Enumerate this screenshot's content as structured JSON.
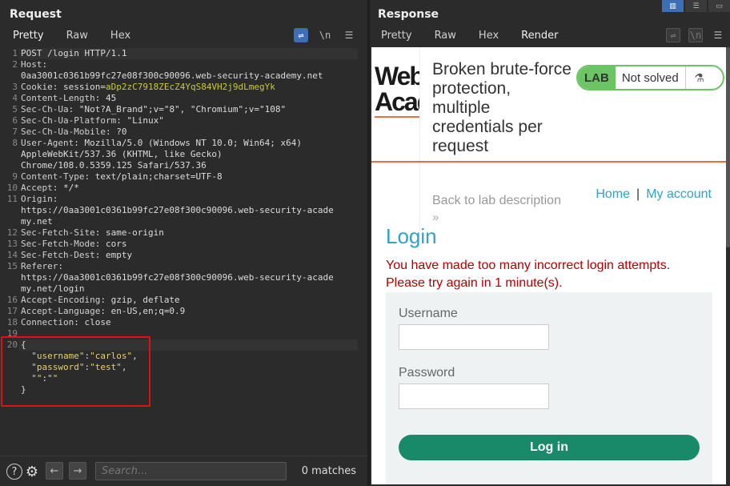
{
  "request": {
    "title": "Request",
    "tabs": [
      "Pretty",
      "Raw",
      "Hex"
    ],
    "tools": {
      "wrap": "⇌",
      "newline": "\\n",
      "menu": "☰"
    },
    "lines": [
      {
        "n": "1",
        "parts": [
          {
            "t": "POST /login HTTP/1.1",
            "c": "v"
          }
        ]
      },
      {
        "n": "2",
        "parts": [
          {
            "t": "Host",
            "c": "k"
          },
          {
            "t": ":",
            "c": "v"
          }
        ]
      },
      {
        "n": "",
        "parts": [
          {
            "t": "0aa3001c0361b99fc27e08f300c90096.web-security-academy.net",
            "c": "v"
          }
        ]
      },
      {
        "n": "3",
        "parts": [
          {
            "t": "Cookie",
            "c": "k"
          },
          {
            "t": ": session=",
            "c": "v"
          },
          {
            "t": "aDp2zC7918ZEcZ4YqS84VH2j9dLmegYk",
            "c": "cv"
          }
        ]
      },
      {
        "n": "4",
        "parts": [
          {
            "t": "Content-Length",
            "c": "k"
          },
          {
            "t": ": 45",
            "c": "v"
          }
        ]
      },
      {
        "n": "5",
        "parts": [
          {
            "t": "Sec-Ch-Ua",
            "c": "k"
          },
          {
            "t": ": \"Not?A_Brand\";v=\"8\", \"Chromium\";v=\"108\"",
            "c": "v"
          }
        ]
      },
      {
        "n": "6",
        "parts": [
          {
            "t": "Sec-Ch-Ua-Platform",
            "c": "k"
          },
          {
            "t": ": \"Linux\"",
            "c": "v"
          }
        ]
      },
      {
        "n": "7",
        "parts": [
          {
            "t": "Sec-Ch-Ua-Mobile",
            "c": "k"
          },
          {
            "t": ": ?0",
            "c": "v"
          }
        ]
      },
      {
        "n": "8",
        "parts": [
          {
            "t": "User-Agent",
            "c": "k"
          },
          {
            "t": ": Mozilla/5.0 (Windows NT 10.0; Win64; x64)",
            "c": "v"
          }
        ]
      },
      {
        "n": "",
        "parts": [
          {
            "t": "AppleWebKit/537.36 (KHTML, like Gecko)",
            "c": "v"
          }
        ]
      },
      {
        "n": "",
        "parts": [
          {
            "t": "Chrome/108.0.5359.125 Safari/537.36",
            "c": "v"
          }
        ]
      },
      {
        "n": "9",
        "parts": [
          {
            "t": "Content-Type",
            "c": "k"
          },
          {
            "t": ": text/plain;charset=UTF-8",
            "c": "v"
          }
        ]
      },
      {
        "n": "10",
        "parts": [
          {
            "t": "Accept",
            "c": "k"
          },
          {
            "t": ": */*",
            "c": "v"
          }
        ]
      },
      {
        "n": "11",
        "parts": [
          {
            "t": "Origin",
            "c": "k"
          },
          {
            "t": ":",
            "c": "v"
          }
        ]
      },
      {
        "n": "",
        "parts": [
          {
            "t": "https://0aa3001c0361b99fc27e08f300c90096.web-security-acade",
            "c": "v"
          }
        ]
      },
      {
        "n": "",
        "parts": [
          {
            "t": "my.net",
            "c": "v"
          }
        ]
      },
      {
        "n": "12",
        "parts": [
          {
            "t": "Sec-Fetch-Site",
            "c": "k"
          },
          {
            "t": ": same-origin",
            "c": "v"
          }
        ]
      },
      {
        "n": "13",
        "parts": [
          {
            "t": "Sec-Fetch-Mode",
            "c": "k"
          },
          {
            "t": ": cors",
            "c": "v"
          }
        ]
      },
      {
        "n": "14",
        "parts": [
          {
            "t": "Sec-Fetch-Dest",
            "c": "k"
          },
          {
            "t": ": empty",
            "c": "v"
          }
        ]
      },
      {
        "n": "15",
        "parts": [
          {
            "t": "Referer",
            "c": "k"
          },
          {
            "t": ":",
            "c": "v"
          }
        ]
      },
      {
        "n": "",
        "parts": [
          {
            "t": "https://0aa3001c0361b99fc27e08f300c90096.web-security-acade",
            "c": "v"
          }
        ]
      },
      {
        "n": "",
        "parts": [
          {
            "t": "my.net/login",
            "c": "v"
          }
        ]
      },
      {
        "n": "16",
        "parts": [
          {
            "t": "Accept-Encoding",
            "c": "k"
          },
          {
            "t": ": gzip, deflate",
            "c": "v"
          }
        ]
      },
      {
        "n": "17",
        "parts": [
          {
            "t": "Accept-Language",
            "c": "k"
          },
          {
            "t": ": en-US,en;q=0.9",
            "c": "v"
          }
        ]
      },
      {
        "n": "18",
        "parts": [
          {
            "t": "Connection",
            "c": "k"
          },
          {
            "t": ": close",
            "c": "v"
          }
        ]
      },
      {
        "n": "19",
        "parts": []
      },
      {
        "n": "20",
        "parts": [
          {
            "t": "{",
            "c": "v"
          }
        ]
      },
      {
        "n": "",
        "parts": [
          {
            "t": "  \"username\"",
            "c": "js"
          },
          {
            "t": ":",
            "c": "v"
          },
          {
            "t": "\"carlos\"",
            "c": "js"
          },
          {
            "t": ",",
            "c": "v"
          }
        ]
      },
      {
        "n": "",
        "parts": [
          {
            "t": "  \"password\"",
            "c": "js"
          },
          {
            "t": ":",
            "c": "v"
          },
          {
            "t": "\"test\"",
            "c": "js"
          },
          {
            "t": ",",
            "c": "v"
          }
        ]
      },
      {
        "n": "",
        "parts": [
          {
            "t": "  \"\"",
            "c": "js"
          },
          {
            "t": ":",
            "c": "v"
          },
          {
            "t": "\"\"",
            "c": "js"
          }
        ]
      },
      {
        "n": "",
        "parts": [
          {
            "t": "}",
            "c": "v"
          }
        ]
      }
    ],
    "search_placeholder": "Search...",
    "matches": "0 matches"
  },
  "response": {
    "title": "Response",
    "tabs": [
      "Pretty",
      "Raw",
      "Hex",
      "Render"
    ],
    "active_tab": "Render",
    "page": {
      "logo_text": "WebAcademy",
      "lab_title": "Broken brute-force protection, multiple credentials per request",
      "lab_label": "LAB",
      "lab_status": "Not solved",
      "back_link": "Back to lab description",
      "back_chevrons": "»",
      "nav_home": "Home",
      "nav_sep": "|",
      "nav_account": "My account",
      "heading": "Login",
      "error_message": "You have made too many incorrect login attempts. Please try again in 1 minute(s).",
      "username_label": "Username",
      "password_label": "Password",
      "login_button": "Log in"
    }
  },
  "colors": {
    "accent_orange": "#e8703a",
    "portswigger_blue": "#2ea3c8",
    "lab_green": "#6cc565",
    "login_button": "#188a6a",
    "error_red": "#b30000",
    "highlight_box": "#e01010"
  }
}
